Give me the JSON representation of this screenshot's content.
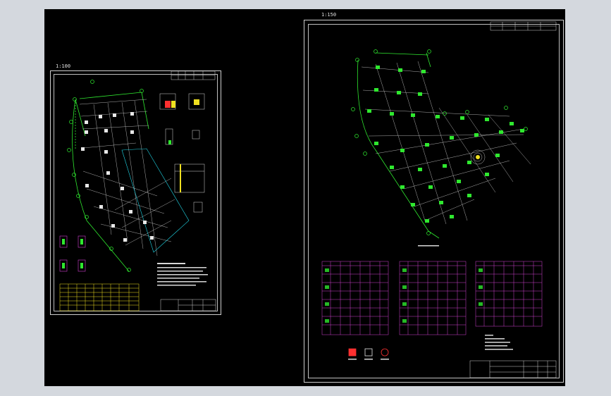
{
  "drawing": {
    "left_sheet_scale": "1:100",
    "right_sheet_scale": "1:150"
  },
  "colors": {
    "background": "#000000",
    "frame": "#d8d8d8",
    "structure_green": "#2fe82f",
    "column_white": "#e8e8e8",
    "table_magenta": "#d040d0",
    "table_yellow": "#f0e020",
    "hatch_cyan": "#20d8e8",
    "marker_red": "#ff3030",
    "application_chrome": "#d4d8de"
  }
}
